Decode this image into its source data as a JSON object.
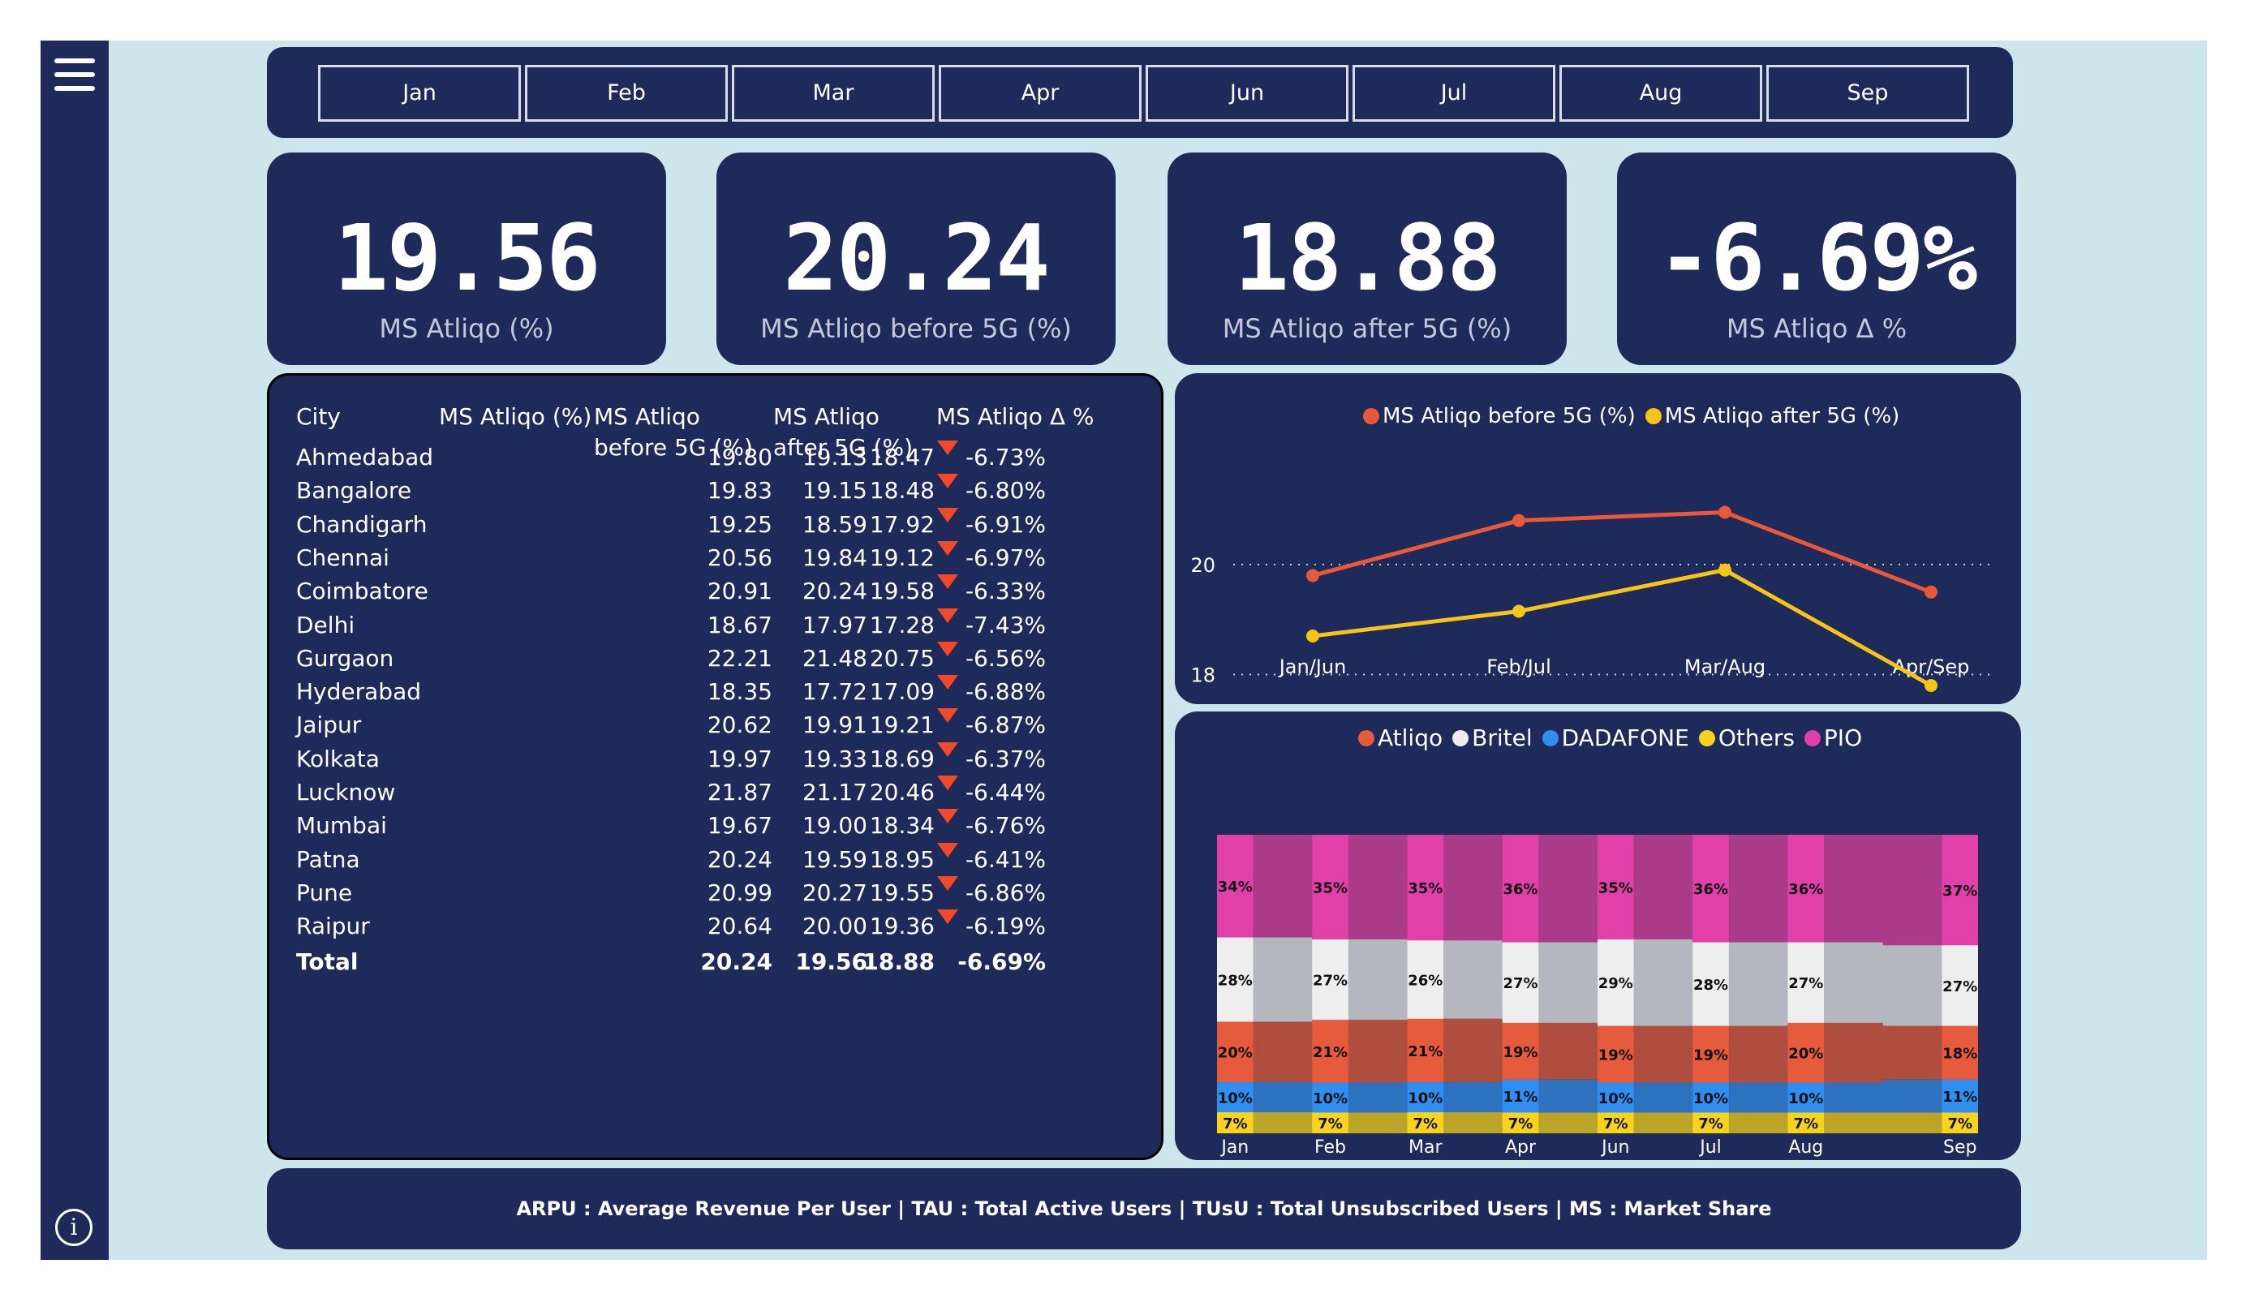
{
  "months": [
    "Jan",
    "Feb",
    "Mar",
    "Apr",
    "Jun",
    "Jul",
    "Aug",
    "Sep"
  ],
  "kpis": [
    {
      "value": "19.56",
      "label": "MS Atliqo (%)"
    },
    {
      "value": "20.24",
      "label": "MS Atliqo before 5G (%)"
    },
    {
      "value": "18.88",
      "label": "MS Atliqo after 5G (%)"
    },
    {
      "value": "-6.69%",
      "label": "MS Atliqo Δ %"
    }
  ],
  "table": {
    "headers": {
      "city": "City",
      "ms": "MS Atliqo (%)",
      "before_1": "MS Atliqo",
      "before_2": "before 5G (%)",
      "after_1": "MS Atliqo",
      "after_2": "after 5G (%)",
      "delta": "MS Atliqo Δ %"
    },
    "rows": [
      {
        "city": "Ahmedabad",
        "ms": "19.13",
        "before": "19.80",
        "after": "18.47",
        "delta": "-6.73%"
      },
      {
        "city": "Bangalore",
        "ms": "19.15",
        "before": "19.83",
        "after": "18.48",
        "delta": "-6.80%"
      },
      {
        "city": "Chandigarh",
        "ms": "18.59",
        "before": "19.25",
        "after": "17.92",
        "delta": "-6.91%"
      },
      {
        "city": "Chennai",
        "ms": "19.84",
        "before": "20.56",
        "after": "19.12",
        "delta": "-6.97%"
      },
      {
        "city": "Coimbatore",
        "ms": "20.24",
        "before": "20.91",
        "after": "19.58",
        "delta": "-6.33%"
      },
      {
        "city": "Delhi",
        "ms": "17.97",
        "before": "18.67",
        "after": "17.28",
        "delta": "-7.43%"
      },
      {
        "city": "Gurgaon",
        "ms": "21.48",
        "before": "22.21",
        "after": "20.75",
        "delta": "-6.56%"
      },
      {
        "city": "Hyderabad",
        "ms": "17.72",
        "before": "18.35",
        "after": "17.09",
        "delta": "-6.88%"
      },
      {
        "city": "Jaipur",
        "ms": "19.91",
        "before": "20.62",
        "after": "19.21",
        "delta": "-6.87%"
      },
      {
        "city": "Kolkata",
        "ms": "19.33",
        "before": "19.97",
        "after": "18.69",
        "delta": "-6.37%"
      },
      {
        "city": "Lucknow",
        "ms": "21.17",
        "before": "21.87",
        "after": "20.46",
        "delta": "-6.44%"
      },
      {
        "city": "Mumbai",
        "ms": "19.00",
        "before": "19.67",
        "after": "18.34",
        "delta": "-6.76%"
      },
      {
        "city": "Patna",
        "ms": "19.59",
        "before": "20.24",
        "after": "18.95",
        "delta": "-6.41%"
      },
      {
        "city": "Pune",
        "ms": "20.27",
        "before": "20.99",
        "after": "19.55",
        "delta": "-6.86%"
      },
      {
        "city": "Raipur",
        "ms": "20.00",
        "before": "20.64",
        "after": "19.36",
        "delta": "-6.19%"
      }
    ],
    "total": {
      "city": "Total",
      "ms": "19.56",
      "before": "20.24",
      "after": "18.88",
      "delta": "-6.69%"
    }
  },
  "footer": "ARPU : Average Revenue Per User | TAU : Total Active Users  | TUsU : Total Unsubscribed Users | MS : Market Share",
  "colors": {
    "panel": "#1e2a5a",
    "canvas": "#cde6ec",
    "down_arrow": "#f04a2a"
  },
  "chart_data": [
    {
      "type": "line",
      "categories": [
        "Jan/Jun",
        "Feb/Jul",
        "Mar/Aug",
        "Apr/Sep"
      ],
      "yticks": [
        18,
        20
      ],
      "ylim": [
        17.8,
        22.3
      ],
      "grid": "dotted",
      "legend": "top-center",
      "series": [
        {
          "name": "MS Atliqo before 5G (%)",
          "color": "#e8593a",
          "values": [
            19.8,
            20.8,
            20.95,
            19.5
          ]
        },
        {
          "name": "MS Atliqo after 5G (%)",
          "color": "#f5c518",
          "values": [
            18.7,
            19.15,
            19.9,
            17.8
          ]
        }
      ]
    },
    {
      "type": "area",
      "stacked": "100%",
      "categories": [
        "Jan",
        "Feb",
        "Mar",
        "Apr",
        "Jun",
        "Jul",
        "Aug",
        "Sep"
      ],
      "legend": "top-center",
      "series": [
        {
          "name": "Others",
          "color": "#f7d31e",
          "values": [
            7,
            7,
            7,
            7,
            7,
            7,
            7,
            7
          ]
        },
        {
          "name": "DADAFONE",
          "color": "#2f8ef0",
          "values": [
            10,
            10,
            10,
            11,
            10,
            10,
            10,
            11
          ]
        },
        {
          "name": "Atliqo",
          "color": "#e55b3c",
          "values": [
            20,
            21,
            21,
            19,
            19,
            19,
            20,
            18
          ]
        },
        {
          "name": "Britel",
          "color": "#eeeeee",
          "values": [
            28,
            27,
            26,
            27,
            29,
            28,
            27,
            27
          ]
        },
        {
          "name": "PIO",
          "color": "#e040a8",
          "values": [
            34,
            35,
            35,
            36,
            35,
            36,
            36,
            37
          ]
        }
      ],
      "legend_order": [
        "Atliqo",
        "Britel",
        "DADAFONE",
        "Others",
        "PIO"
      ]
    }
  ]
}
